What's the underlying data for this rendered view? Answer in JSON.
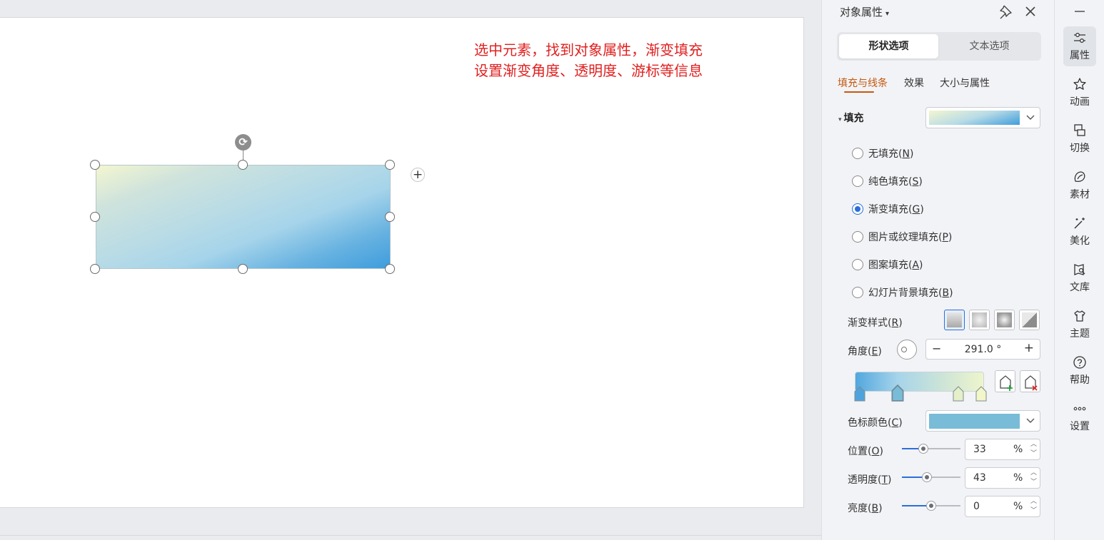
{
  "annotation": {
    "line1": "选中元素，找到对象属性，渐变填充",
    "line2": "设置渐变角度、透明度、游标等信息",
    "color": "#e02020"
  },
  "panel": {
    "title": "对象属性",
    "title_caret": "▾",
    "tabs": {
      "shape": "形状选项",
      "text": "文本选项",
      "active": "shape"
    },
    "subtabs": {
      "fill": "填充与线条",
      "effect": "效果",
      "size": "大小与属性",
      "active": "fill"
    },
    "fill": {
      "section_label": "填充",
      "section_caret": "▾",
      "options": [
        {
          "label": "无填充",
          "key": "N",
          "selected": false
        },
        {
          "label": "纯色填充",
          "key": "S",
          "selected": false
        },
        {
          "label": "渐变填充",
          "key": "G",
          "selected": true
        },
        {
          "label": "图片或纹理填充",
          "key": "P",
          "selected": false
        },
        {
          "label": "图案填充",
          "key": "A",
          "selected": false
        },
        {
          "label": "幻灯片背景填充",
          "key": "B",
          "selected": false
        }
      ]
    },
    "gradient_style": {
      "label": "渐变样式",
      "key": "R",
      "styles": [
        "linear",
        "radial",
        "rectangular",
        "path"
      ],
      "selected": 0
    },
    "angle": {
      "label": "角度",
      "key": "E",
      "minus": "−",
      "plus": "+",
      "value": "291.0 °"
    },
    "gradient_stops": {
      "positions_pct": [
        4,
        33,
        80,
        98
      ],
      "selected": 1,
      "colors": [
        "#4ea3dc",
        "#79bcd8",
        "#e5efc8",
        "#f2f6c8"
      ]
    },
    "stop_color": {
      "label": "色标颜色",
      "key": "C",
      "value": "#79bcd8"
    },
    "position": {
      "label": "位置",
      "key": "O",
      "value": "33",
      "unit": "%",
      "slider": 0.37
    },
    "transparency": {
      "label": "透明度",
      "key": "T",
      "value": "43",
      "unit": "%",
      "slider": 0.43
    },
    "brightness": {
      "label": "亮度",
      "key": "B",
      "value": "0",
      "unit": "%",
      "slider": 0.5
    }
  },
  "toolbar": {
    "items": [
      {
        "label": "属性",
        "icon": "sliders-icon",
        "active": true
      },
      {
        "label": "动画",
        "icon": "star-icon",
        "active": false
      },
      {
        "label": "切换",
        "icon": "switch-icon",
        "active": false
      },
      {
        "label": "素材",
        "icon": "material-icon",
        "active": false
      },
      {
        "label": "美化",
        "icon": "magic-wand-icon",
        "active": false
      },
      {
        "label": "文库",
        "icon": "library-icon",
        "active": false
      },
      {
        "label": "主题",
        "icon": "shirt-icon",
        "active": false
      },
      {
        "label": "帮助",
        "icon": "help-icon",
        "active": false
      },
      {
        "label": "设置",
        "icon": "more-icon",
        "active": false
      }
    ]
  },
  "colors": {
    "accent": "#2a6fdb",
    "subtab_active": "#c4580e"
  }
}
